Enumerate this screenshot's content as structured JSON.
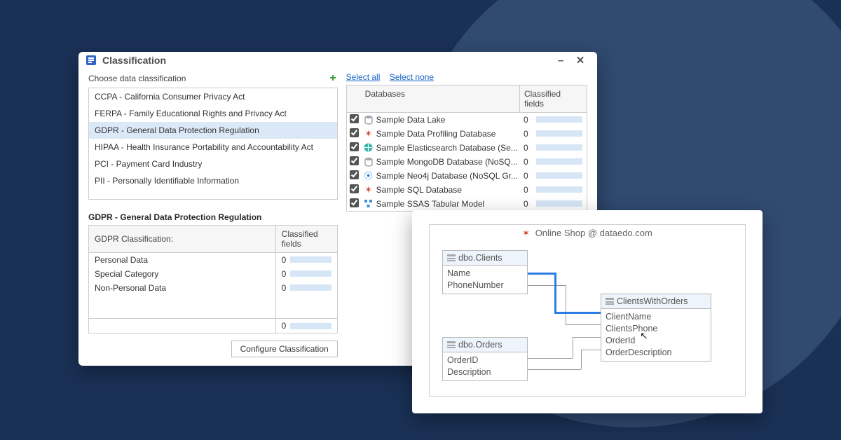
{
  "window": {
    "title": "Classification",
    "choose_label": "Choose data classification",
    "classifications": [
      "CCPA - California Consumer Privacy Act",
      "FERPA - Family Educational Rights and Privacy Act",
      "GDPR - General Data Protection Regulation",
      "HIPAA - Health Insurance Portability and Accountability Act",
      "PCI - Payment Card Industry",
      "PII - Personally Identifiable Information"
    ],
    "selected_index": 2,
    "detail_title": "GDPR - General Data Protection Regulation",
    "detail_header_name": "GDPR Classification:",
    "detail_header_count": "Classified fields",
    "detail_rows": [
      {
        "name": "Personal Data",
        "count": 0
      },
      {
        "name": "Special Category",
        "count": 0
      },
      {
        "name": "Non-Personal Data",
        "count": 0
      }
    ],
    "detail_total": 0,
    "configure_label": "Configure Classification",
    "select_all": "Select all",
    "select_none": "Select none",
    "db_header_name": "Databases",
    "db_header_count": "Classified fields",
    "databases": [
      {
        "name": "Sample Data Lake",
        "count": 0,
        "checked": true
      },
      {
        "name": "Sample Data Profiling Database",
        "count": 0,
        "checked": true
      },
      {
        "name": "Sample Elasticsearch Database (Se...",
        "count": 0,
        "checked": true
      },
      {
        "name": "Sample MongoDB Database (NoSQ...",
        "count": 0,
        "checked": true
      },
      {
        "name": "Sample Neo4j Database (NoSQL Gr...",
        "count": 0,
        "checked": true
      },
      {
        "name": "Sample SQL Database",
        "count": 0,
        "checked": true
      },
      {
        "name": "Sample SSAS Tabular Model",
        "count": 0,
        "checked": true
      }
    ]
  },
  "diagram": {
    "title": "Online Shop @ dataedo.com",
    "entities": {
      "clients": {
        "title": "dbo.Clients",
        "fields": [
          "Name",
          "PhoneNumber"
        ]
      },
      "orders": {
        "title": "dbo.Orders",
        "fields": [
          "OrderID",
          "Description"
        ]
      },
      "view": {
        "title": "ClientsWithOrders",
        "fields": [
          "ClientName",
          "ClientsPhone",
          "OrderId",
          "OrderDescription"
        ]
      }
    }
  },
  "colors": {
    "background": "#1a3156",
    "blob": "#304a70",
    "selection": "#dbe8f7",
    "link": "#1865c7",
    "relation": "#2a7de1"
  }
}
